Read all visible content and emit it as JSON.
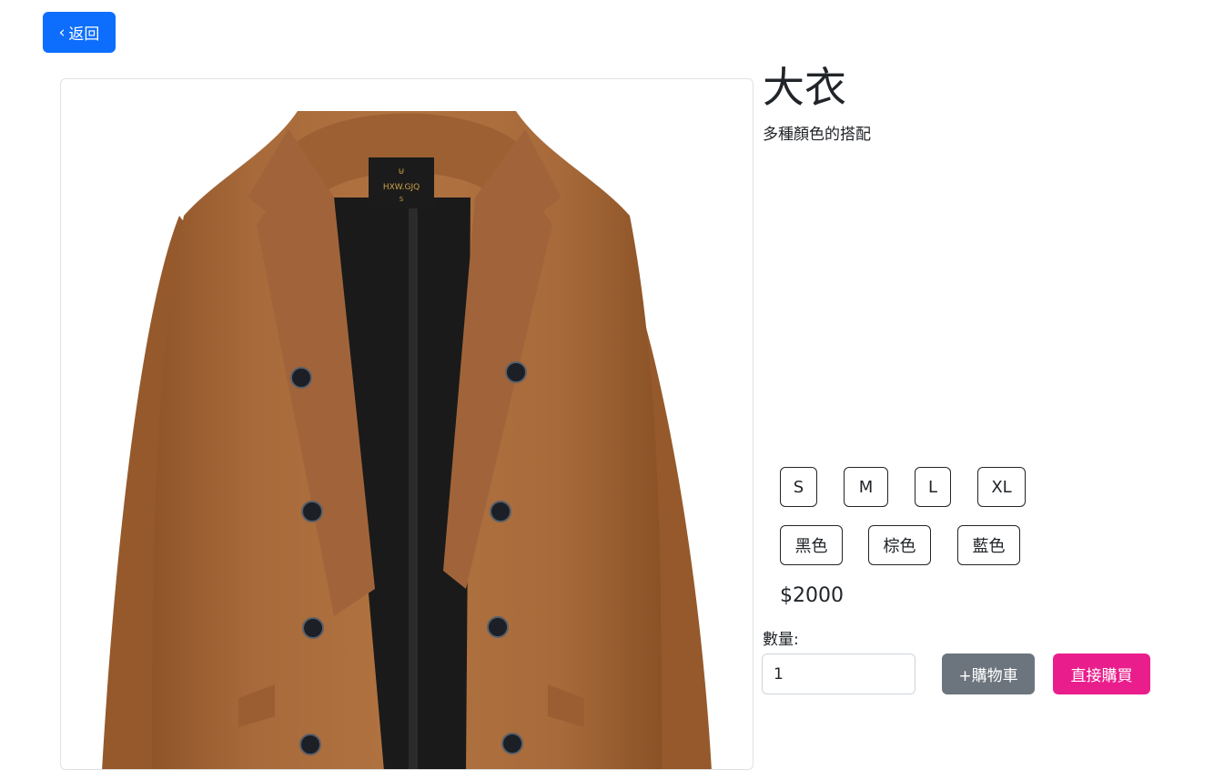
{
  "nav": {
    "back_label": "返回",
    "back_icon": "chevron-left-icon"
  },
  "product": {
    "title": "大衣",
    "description": "多種顏色的搭配",
    "image_label": "HXW.GJQ",
    "image_size_tag": "S",
    "price": "$2000"
  },
  "sizes": [
    "S",
    "M",
    "L",
    "XL"
  ],
  "colors": [
    "黑色",
    "棕色",
    "藍色"
  ],
  "quantity": {
    "label": "數量:",
    "value": "1"
  },
  "actions": {
    "add_to_cart": "+購物車",
    "buy_now": "直接購買"
  },
  "theme": {
    "primary": "#0d6efd",
    "secondary": "#6c757d",
    "buy": "#e91e8c",
    "coat": "#a86a3a"
  }
}
